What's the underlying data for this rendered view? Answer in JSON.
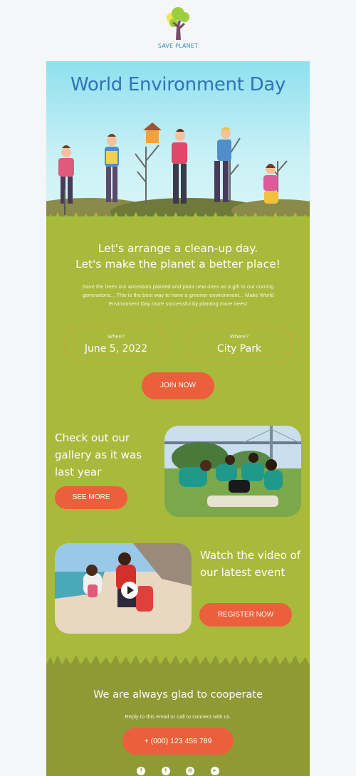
{
  "logo": {
    "icon": "tree-logo-icon",
    "brand": "SAVE PLANET"
  },
  "hero": {
    "title": "World Environment Day"
  },
  "intro": {
    "heading_line1": "Let's arrange a clean-up day.",
    "heading_line2": "Let's make the planet a better place!",
    "paragraph": "Save the trees our ancestors planted and plant new ones as a gift to our coming generations... This is the best way to have a greener environment... Make World Environment Day more successful by planting more trees!"
  },
  "event": {
    "when_label": "When?",
    "when_value": "June 5, 2022",
    "where_label": "Where?",
    "where_value": "City Park"
  },
  "join_button": "JOIN NOW",
  "gallery": {
    "heading": "Check out our gallery as it was last year",
    "button": "SEE MORE"
  },
  "video": {
    "heading": "Watch the video of our latest event",
    "button": "REGISTER NOW",
    "play_icon": "play-icon"
  },
  "footer": {
    "heading": "We are always glad to cooperate",
    "text": "Reply to this email or call to connect with us.",
    "phone": "+ (000) 123 456 789",
    "socials": [
      "facebook-icon",
      "twitter-icon",
      "instagram-icon",
      "youtube-icon"
    ]
  },
  "colors": {
    "page_bg": "#f4f6f8",
    "email_bg": "#a8b93c",
    "footer_bg": "#8f9a35",
    "accent": "#ec5f3c",
    "title_blue": "#2e74b6"
  }
}
